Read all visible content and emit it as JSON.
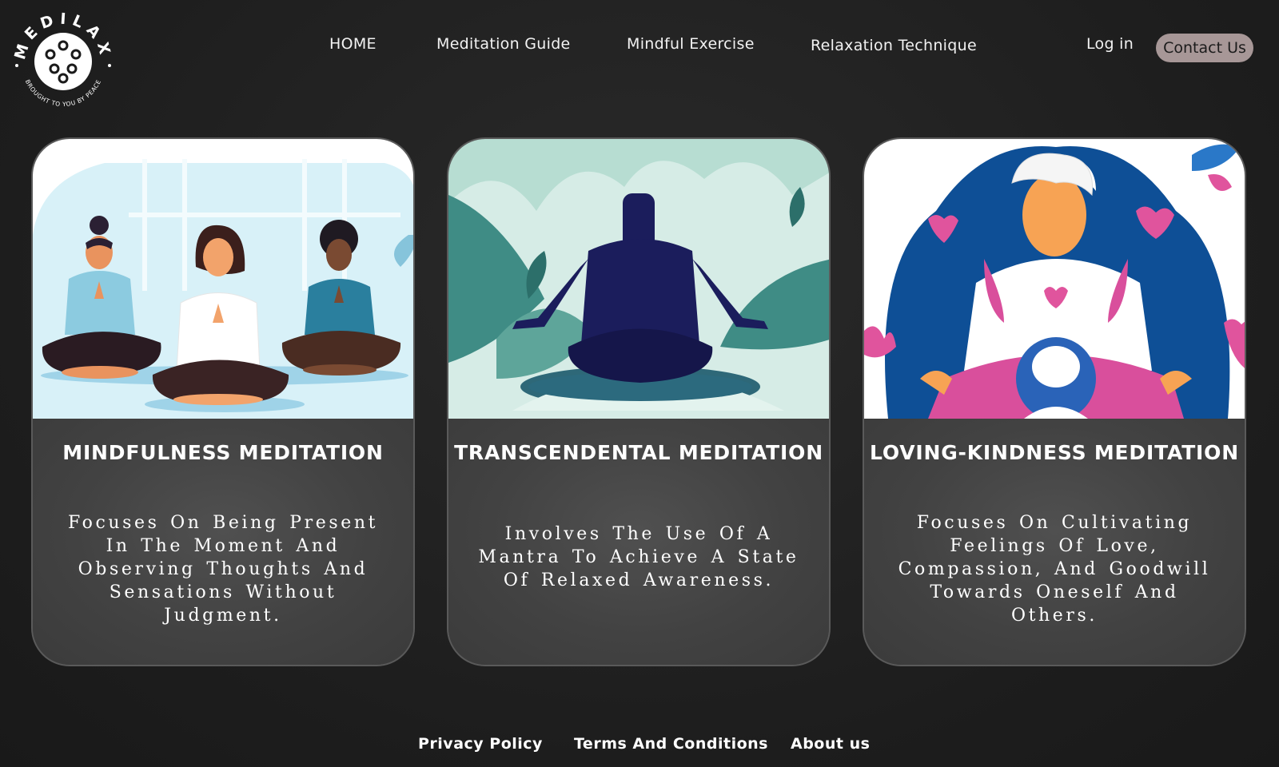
{
  "logo": {
    "brand": "MEDILAX",
    "tagline": "BROUGHT TO YOU BY PEACE"
  },
  "nav": {
    "home": "HOME",
    "meditation_guide": "Meditation Guide",
    "mindful_exercise": "Mindful Exercise",
    "relaxation_technique": "Relaxation Technique",
    "login": "Log in",
    "contact": "Contact Us"
  },
  "cards": [
    {
      "title": "MINDFULNESS MEDITATION",
      "description": "Focuses On Being Present In The Moment And Observing Thoughts And Sensations Without Judgment."
    },
    {
      "title": "TRANSCENDENTAL MEDITATION",
      "description": "Involves The Use Of A Mantra To Achieve A State Of Relaxed Awareness."
    },
    {
      "title": "LOVING-KINDNESS MEDITATION",
      "description": "Focuses On Cultivating Feelings Of Love, Compassion, And Goodwill Towards Oneself And Others."
    }
  ],
  "footer": {
    "privacy": "Privacy Policy",
    "terms": "Terms And Conditions",
    "about": "About us"
  },
  "colors": {
    "background": "#1d1d1d",
    "card": "#444444",
    "contact_button": "#a79797"
  }
}
